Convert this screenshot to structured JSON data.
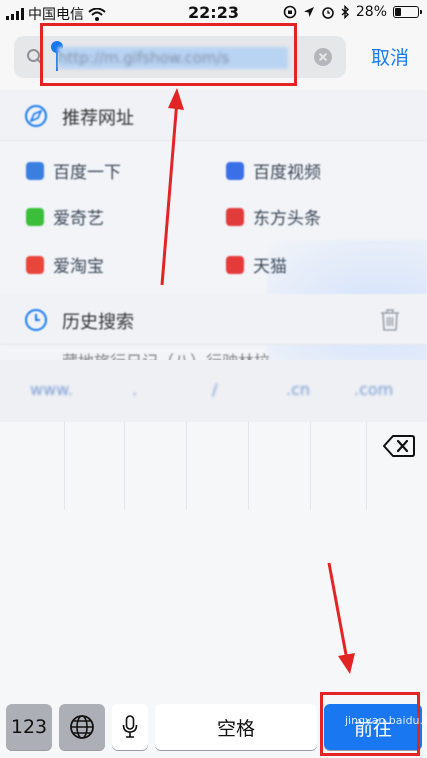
{
  "status_bar": {
    "carrier": "中国电信",
    "time": "22:23",
    "battery": "28%",
    "battery_level": 0.28
  },
  "search": {
    "url_value": "http://m.gifshow.com/s",
    "cancel_label": "取消"
  },
  "recommended": {
    "title": "推荐网址",
    "sites": [
      {
        "label": "百度一下",
        "color": "#3a7fe0"
      },
      {
        "label": "百度视频",
        "color": "#3b6fe8"
      },
      {
        "label": "爱奇艺",
        "color": "#3bbf3b"
      },
      {
        "label": "东方头条",
        "color": "#e23b3b"
      },
      {
        "label": "爱淘宝",
        "color": "#e8463a"
      },
      {
        "label": "天猫",
        "color": "#e53a3a"
      }
    ]
  },
  "history": {
    "title": "历史搜索",
    "first_item": "藏地旅行日记（八）行驶林拉"
  },
  "suggestions": [
    "www.",
    ".",
    "/",
    ".cn",
    ".com"
  ],
  "keyboard": {
    "numbers_label": "123",
    "space_label": "空格",
    "go_label": "前往"
  },
  "watermark": "jingyan.baidu.com",
  "colors": {
    "accent": "#1a7bf0",
    "highlight": "#e32424"
  }
}
